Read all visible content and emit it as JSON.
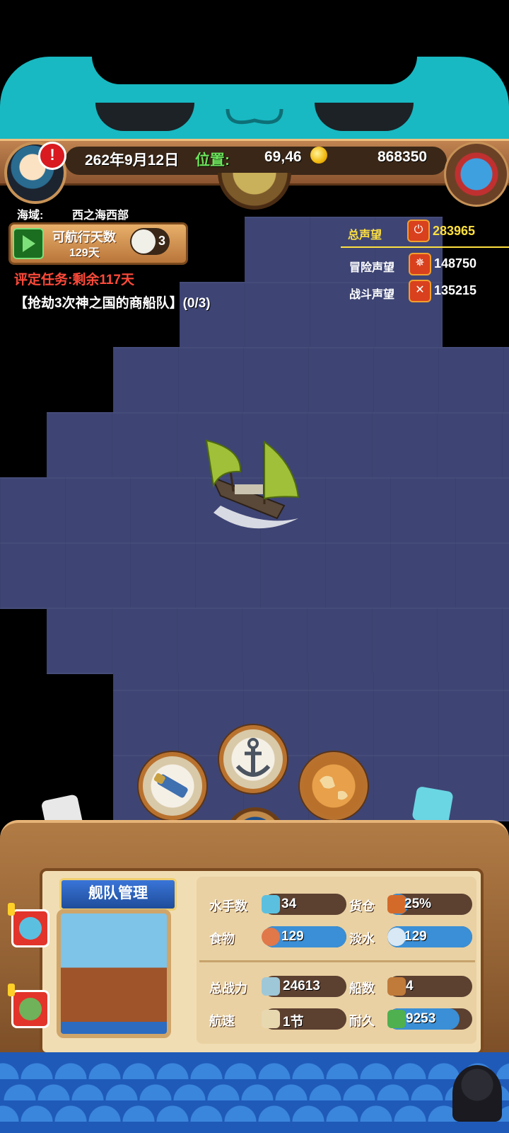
{
  "hud": {
    "date": "262年9月12日",
    "position_label": "位置:",
    "position_value": "69,46",
    "gold": "868350",
    "alert_mark": "!"
  },
  "region": {
    "label": "海域:",
    "value": "西之海西部"
  },
  "sail_days": {
    "label": "可航行天数",
    "value": "129天",
    "compass_count": "3"
  },
  "task": {
    "rating": "评定任务:剩余117天",
    "mission": "【抢劫3次神之国的商船队】(0/3)"
  },
  "reputation": {
    "total_label": "总声望",
    "total_value": "283965",
    "adventure_label": "冒险声望",
    "adventure_value": "148750",
    "battle_label": "战斗声望",
    "battle_value": "135215"
  },
  "fleet": {
    "title": "舰队管理",
    "stats": {
      "sailors_label": "水手数",
      "sailors_value": "34",
      "cargo_label": "货仓",
      "cargo_value": "25%",
      "cargo_fill": 0.25,
      "food_label": "食物",
      "food_value": "129",
      "food_fill": 1.0,
      "water_label": "淡水",
      "water_value": "129",
      "water_fill": 1.0,
      "power_label": "总战力",
      "power_value": "24613",
      "ships_label": "船数",
      "ships_value": "4",
      "speed_label": "航速",
      "speed_value": "1节",
      "durability_label": "耐久",
      "durability_value": "9253",
      "durability_fill": 0.85
    }
  },
  "colors": {
    "sea": "#3e4574",
    "banner": "#18b9c2",
    "bar_fill": "#3a8fd6",
    "gold_text": "#ffe040",
    "task_red": "#ff4a3a"
  },
  "icons": [
    "alert-icon",
    "coin-icon",
    "treasure-chest-icon",
    "globe-icon",
    "play-icon",
    "compass-icon",
    "spyglass-icon",
    "anchor-icon",
    "world-map-icon",
    "ship-wheel-icon",
    "sailor-icon",
    "cargo-icon",
    "meat-icon",
    "water-jug-icon",
    "power-icon",
    "ships-icon",
    "speed-icon",
    "durability-icon"
  ]
}
